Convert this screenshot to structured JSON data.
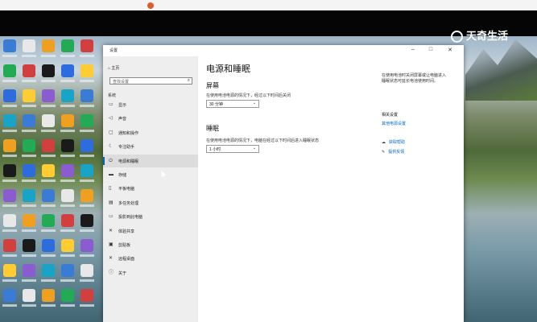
{
  "watermark": "天奇生活",
  "window": {
    "title": "设置",
    "controls": {
      "minimize": "–",
      "maximize": "□",
      "close": "✕"
    }
  },
  "sidebar": {
    "home": "主页",
    "search_placeholder": "查找设置",
    "section": "系统",
    "items": [
      {
        "label": "显示",
        "icon": "display-icon",
        "glyph": "▭"
      },
      {
        "label": "声音",
        "icon": "sound-icon",
        "glyph": "◁"
      },
      {
        "label": "通知和操作",
        "icon": "notification-icon",
        "glyph": "▢"
      },
      {
        "label": "专注助手",
        "icon": "moon-icon",
        "glyph": "☾"
      },
      {
        "label": "电源和睡眠",
        "icon": "power-icon",
        "glyph": "⏻"
      },
      {
        "label": "存储",
        "icon": "storage-icon",
        "glyph": "▬"
      },
      {
        "label": "平板电脑",
        "icon": "tablet-icon",
        "glyph": "▯"
      },
      {
        "label": "多任务处理",
        "icon": "multitask-icon",
        "glyph": "▤"
      },
      {
        "label": "投影到此电脑",
        "icon": "projector-icon",
        "glyph": "▭"
      },
      {
        "label": "体验共享",
        "icon": "share-icon",
        "glyph": "✕"
      },
      {
        "label": "剪贴板",
        "icon": "clipboard-icon",
        "glyph": "▣"
      },
      {
        "label": "远程桌面",
        "icon": "remote-icon",
        "glyph": "✕"
      },
      {
        "label": "关于",
        "icon": "info-icon",
        "glyph": "ⓘ"
      }
    ]
  },
  "main": {
    "page_title": "电源和睡眠",
    "screen": {
      "heading": "屏幕",
      "label": "在使用电池电源的情况下，经过以下时间后关闭",
      "value": "30 分钟"
    },
    "sleep": {
      "heading": "睡眠",
      "label": "在使用电池电源的情况下，电脑在经过以下时间后进入睡眠状态",
      "value": "1 小时"
    }
  },
  "related": {
    "tip": "在使用电池时关闭屏幕或让电脑进入睡眠状态可延长电池使用时间。",
    "heading": "相关设置",
    "link": "其他电源设置",
    "help_link": "获取帮助",
    "feedback_link": "提供反馈"
  }
}
